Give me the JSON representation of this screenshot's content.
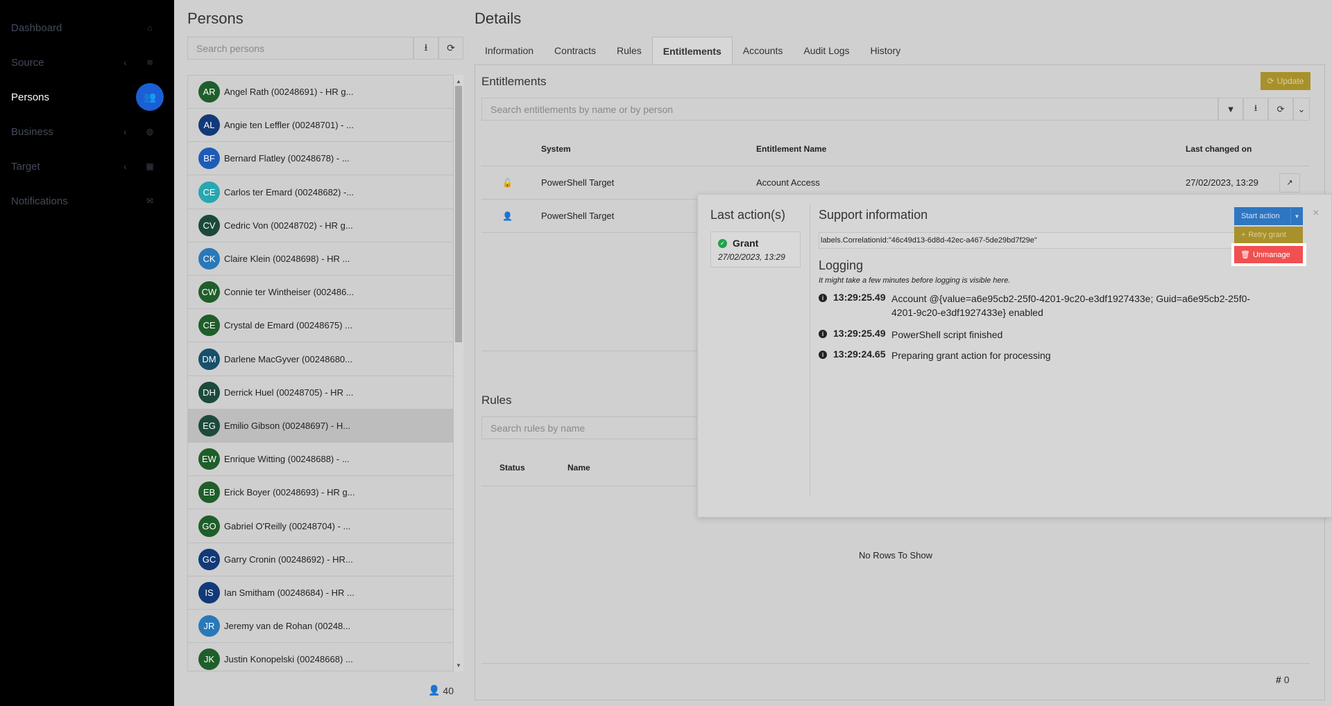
{
  "sidebar": {
    "items": [
      {
        "label": "Dashboard",
        "icon": "home-icon",
        "has_chevron": false
      },
      {
        "label": "Source",
        "icon": "layers-icon",
        "has_chevron": true
      },
      {
        "label": "Persons",
        "icon": "users-icon",
        "has_chevron": false,
        "active": true
      },
      {
        "label": "Business",
        "icon": "globe-icon",
        "has_chevron": true
      },
      {
        "label": "Target",
        "icon": "grid-icon",
        "has_chevron": true
      },
      {
        "label": "Notifications",
        "icon": "envelope-icon",
        "has_chevron": false
      }
    ]
  },
  "persons": {
    "title": "Persons",
    "search_placeholder": "Search persons",
    "count": "40",
    "list": [
      {
        "initials": "AR",
        "name": "Angel Rath (00248691) - HR g...",
        "color": "#1f5e2a"
      },
      {
        "initials": "AL",
        "name": "Angie ten Leffler (00248701) - ...",
        "color": "#123a78"
      },
      {
        "initials": "BF",
        "name": "Bernard Flatley (00248678) - ...",
        "color": "#1f5cb8"
      },
      {
        "initials": "CE",
        "name": "Carlos ter Emard (00248682) -...",
        "color": "#27a7b0"
      },
      {
        "initials": "CV",
        "name": "Cedric Von (00248702) - HR g...",
        "color": "#1b4a3c"
      },
      {
        "initials": "CK",
        "name": "Claire Klein (00248698) - HR ...",
        "color": "#2a78b8"
      },
      {
        "initials": "CW",
        "name": "Connie ter Wintheiser (002486...",
        "color": "#1f5e2a"
      },
      {
        "initials": "CE",
        "name": "Crystal de Emard (00248675) ...",
        "color": "#1f5e2a"
      },
      {
        "initials": "DM",
        "name": "Darlene MacGyver (00248680...",
        "color": "#17506a"
      },
      {
        "initials": "DH",
        "name": "Derrick Huel (00248705) - HR ...",
        "color": "#1b4a3c"
      },
      {
        "initials": "EG",
        "name": "Emilio Gibson (00248697) - H...",
        "color": "#1b4a3c",
        "selected": true
      },
      {
        "initials": "EW",
        "name": "Enrique Witting (00248688) - ...",
        "color": "#1f5e2a"
      },
      {
        "initials": "EB",
        "name": "Erick Boyer (00248693) - HR g...",
        "color": "#1f5e2a"
      },
      {
        "initials": "GO",
        "name": "Gabriel O'Reilly (00248704) - ...",
        "color": "#1f5e2a"
      },
      {
        "initials": "GC",
        "name": "Garry Cronin (00248692) - HR...",
        "color": "#123a78"
      },
      {
        "initials": "IS",
        "name": "Ian Smitham (00248684) - HR ...",
        "color": "#123a78"
      },
      {
        "initials": "JR",
        "name": "Jeremy van de Rohan (00248...",
        "color": "#2a78b8"
      },
      {
        "initials": "JK",
        "name": "Justin Konopelski (00248668) ...",
        "color": "#1f5e2a"
      }
    ]
  },
  "details": {
    "title": "Details",
    "tabs": [
      "Information",
      "Contracts",
      "Rules",
      "Entitlements",
      "Accounts",
      "Audit Logs",
      "History"
    ],
    "active_tab": "Entitlements"
  },
  "entitlements": {
    "title": "Entitlements",
    "update_label": "Update",
    "search_placeholder": "Search entitlements by name or by person",
    "columns": {
      "system": "System",
      "name": "Entitlement Name",
      "changed": "Last changed on"
    },
    "rows": [
      {
        "icon": "unlock-icon",
        "system": "PowerShell Target",
        "name": "Account Access",
        "changed": "27/02/2023, 13:29"
      },
      {
        "icon": "user-icon",
        "system": "PowerShell Target",
        "name": "",
        "changed": ""
      }
    ]
  },
  "rules": {
    "title": "Rules",
    "search_placeholder": "Search rules by name",
    "columns": {
      "status": "Status",
      "name": "Name"
    },
    "empty_text": "No Rows To Show",
    "count": "0"
  },
  "popup": {
    "last_action_title": "Last action(s)",
    "action_name": "Grant",
    "action_date": "27/02/2023, 13:29",
    "support_title": "Support information",
    "correlation": "labels.CorrelationId:\"46c49d13-6d8d-42ec-a467-5de29bd7f29e\"",
    "logging_title": "Logging",
    "logging_note": "It might take a few minutes before logging is visible here.",
    "logs": [
      {
        "time": "13:29:25.49",
        "message": "Account @{value=a6e95cb2-25f0-4201-9c20-e3df1927433e; Guid=a6e95cb2-25f0-4201-9c20-e3df1927433e} enabled"
      },
      {
        "time": "13:29:25.49",
        "message": "PowerShell script finished"
      },
      {
        "time": "13:29:24.65",
        "message": "Preparing grant action for processing"
      }
    ],
    "start_action_label": "Start action",
    "retry_label": "Retry grant",
    "unmanage_label": "Unmanage",
    "close_label": "×"
  }
}
